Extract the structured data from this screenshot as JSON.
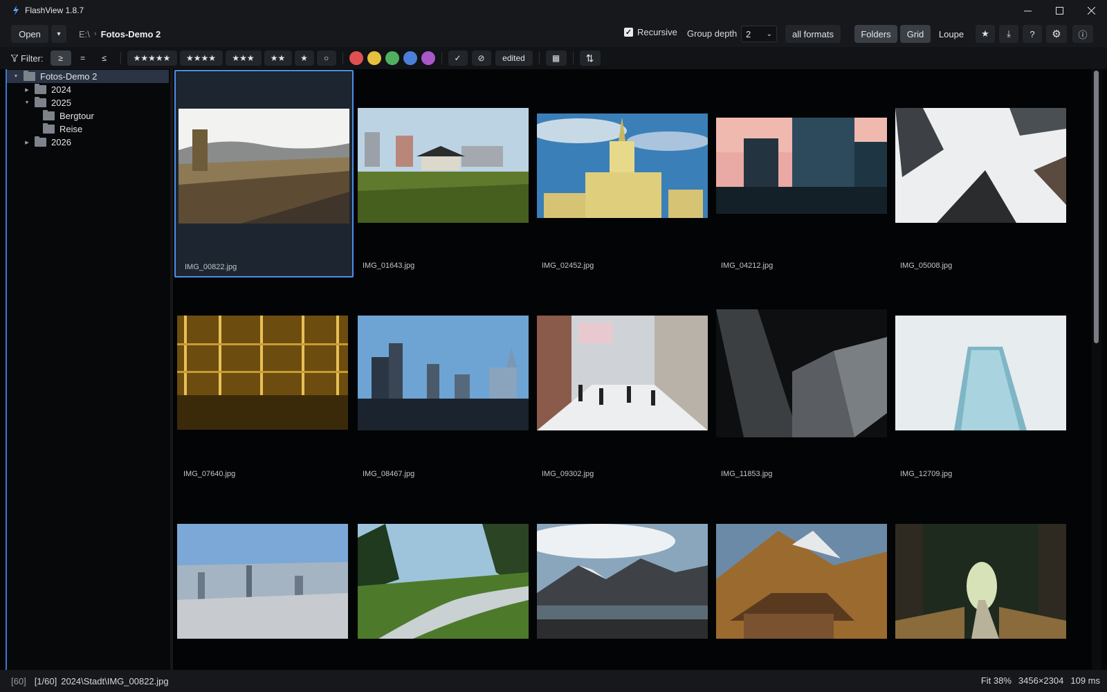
{
  "window": {
    "title": "FlashView 1.8.7",
    "minimize": "—",
    "maximize": "☐",
    "close": "✕"
  },
  "toolbar": {
    "open_label": "Open",
    "open_menu": "▾",
    "breadcrumb_root": "E:\\",
    "breadcrumb_sep": "›",
    "breadcrumb_current": "Fotos-Demo 2",
    "recursive_label": "Recursive",
    "recursive_checked": true,
    "group_depth_label": "Group depth",
    "group_depth_value": "2",
    "formats_label": "all formats",
    "view_folders": "Folders",
    "view_grid": "Grid",
    "view_loupe": "Loupe",
    "star_icon": "★",
    "download_icon": "⤓",
    "help_icon": "?",
    "settings_icon": "⚙",
    "info_icon": "ⓘ"
  },
  "filter": {
    "label": "Filter:",
    "cmp_ge": "≥",
    "cmp_eq": "=",
    "cmp_le": "≤",
    "stars5": "★★★★★",
    "stars4": "★★★★",
    "stars3": "★★★",
    "stars2": "★★",
    "stars1": "★",
    "stars0": "○",
    "colors": [
      "#e05050",
      "#e8c040",
      "#50b060",
      "#4a80d8",
      "#a858c8"
    ],
    "picked": "✓",
    "rejected": "⊘",
    "edited": "edited",
    "calendar_icon": "▦",
    "sort_icon": "⇅"
  },
  "tree": {
    "root": "Fotos-Demo 2",
    "y2024": "2024",
    "y2025": "2025",
    "bergtour": "Bergtour",
    "reise": "Reise",
    "y2026": "2026",
    "expanded_glyph": "▼",
    "collapsed_glyph": "▶"
  },
  "grid": {
    "files": [
      "IMG_00822.jpg",
      "IMG_01643.jpg",
      "IMG_02452.jpg",
      "IMG_04212.jpg",
      "IMG_05008.jpg",
      "IMG_07640.jpg",
      "IMG_08467.jpg",
      "IMG_09302.jpg",
      "IMG_11853.jpg",
      "IMG_12709.jpg"
    ]
  },
  "status": {
    "count": "[60]",
    "position": "[1/60]",
    "path": "2024\\Stadt\\IMG_00822.jpg",
    "zoom": "Fit 38%",
    "dimensions": "3456×2304",
    "timing": "109 ms"
  }
}
